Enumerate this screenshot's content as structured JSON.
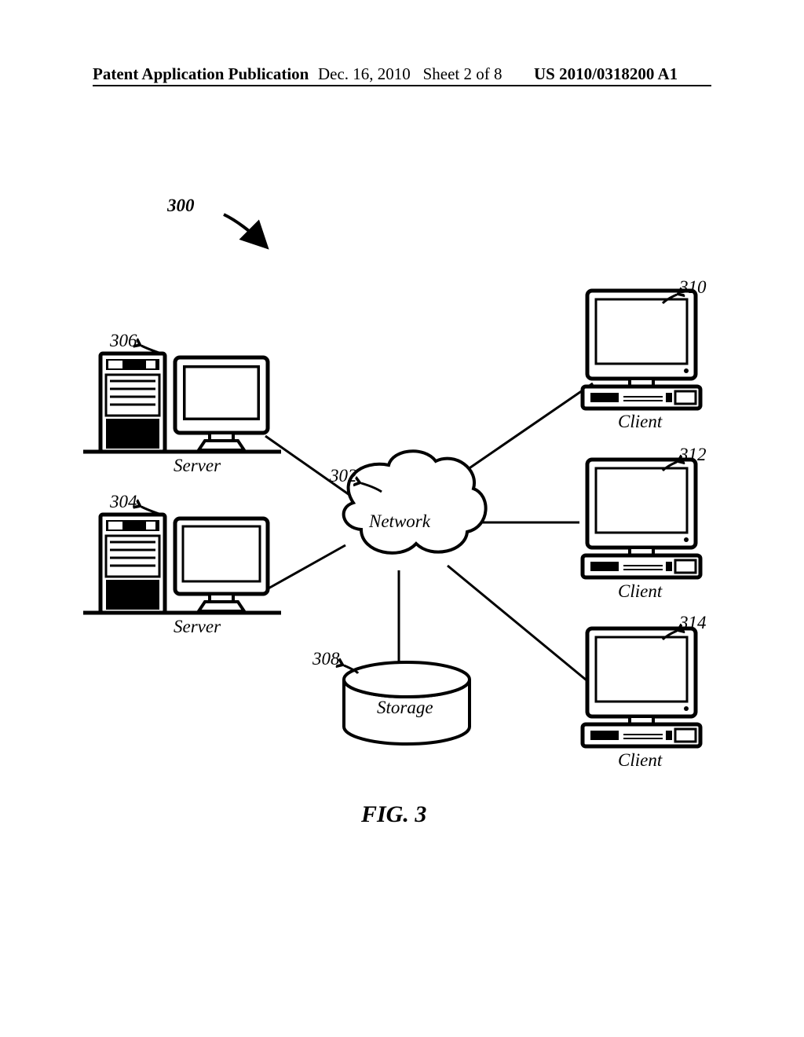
{
  "header": {
    "left": "Patent Application Publication",
    "mid_date": "Dec. 16, 2010",
    "mid_sheet": "Sheet 2 of 8",
    "right": "US 2010/0318200 A1"
  },
  "figure": {
    "caption": "FIG. 3",
    "overall_ref": "300",
    "network_label": "Network",
    "storage_label": "Storage",
    "server_label": "Server",
    "client_label": "Client",
    "refs": {
      "network": "302",
      "server_bottom": "304",
      "server_top": "306",
      "storage": "308",
      "client_top": "310",
      "client_mid": "312",
      "client_bot": "314"
    }
  }
}
